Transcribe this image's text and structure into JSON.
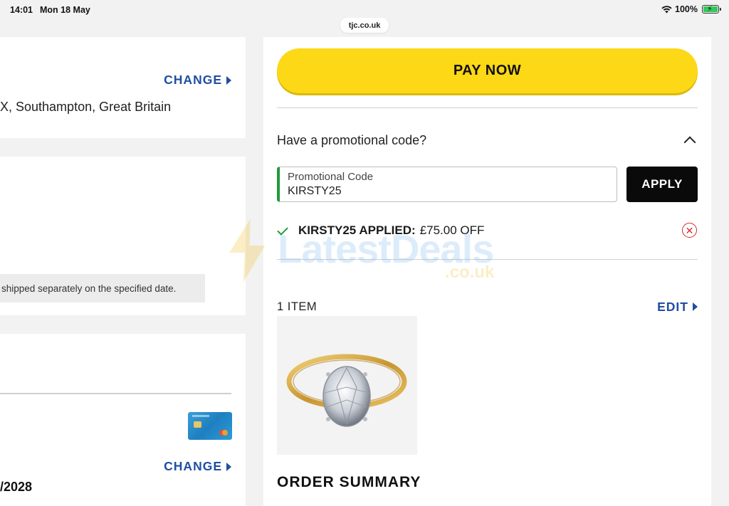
{
  "status_bar": {
    "time": "14:01",
    "date": "Mon 18 May",
    "battery": "100%"
  },
  "browser": {
    "url": "tjc.co.uk"
  },
  "left": {
    "address": {
      "change_label": "CHANGE",
      "text": "X, Southampton, Great Britain"
    },
    "delivery": {
      "note": "shipped separately on the specified date."
    },
    "payment": {
      "change_label": "CHANGE",
      "expiry_partial": "/2028"
    }
  },
  "checkout": {
    "pay_label": "PAY NOW",
    "promo_question": "Have a promotional code?",
    "promo_field_label": "Promotional Code",
    "promo_value": "KIRSTY25",
    "apply_label": "APPLY",
    "applied_code": "KIRSTY25 APPLIED:",
    "applied_amount": "£75.00 OFF",
    "items_count": "1 ITEM",
    "edit_label": "EDIT",
    "order_summary": "ORDER SUMMARY"
  },
  "watermark": {
    "text": "LatestDeals",
    "sub": ".co.uk"
  },
  "colors": {
    "pay_button": "#fdd816",
    "link_blue": "#1f4ea3",
    "success_green": "#1f9a3a",
    "remove_red": "#d12c2c"
  }
}
